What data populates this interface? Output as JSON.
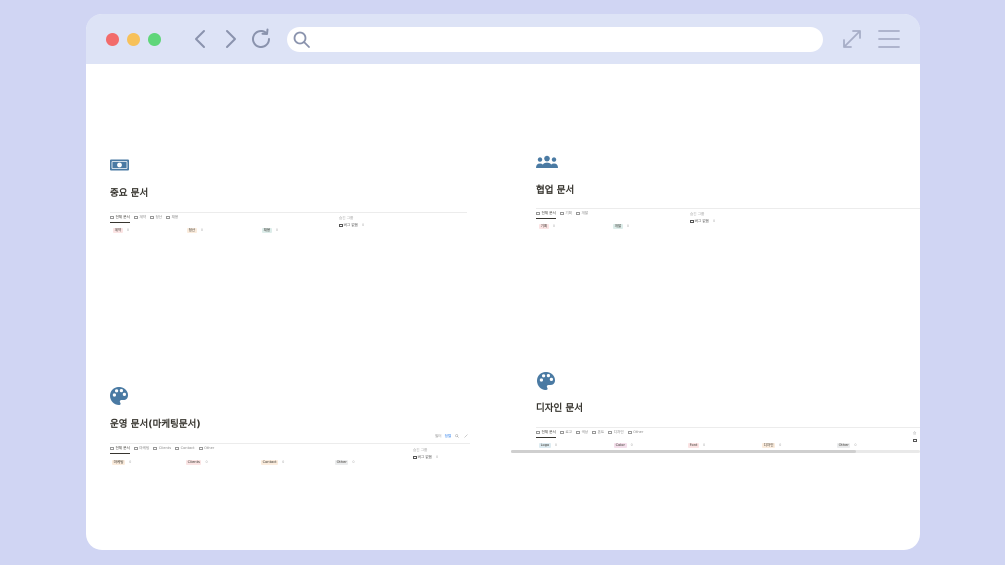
{
  "browser": {
    "url_value": "",
    "url_placeholder": "",
    "icons": [
      "back-icon",
      "forward-icon",
      "reload-icon",
      "search-icon",
      "expand-icon",
      "menu-icon"
    ]
  },
  "colors": {
    "background": "#d0d5f3",
    "titlebar": "#dde3f6",
    "section_icon": "#4a7aa3",
    "badge_red": "#fbe4e4",
    "badge_orange": "#fbecdd",
    "badge_green": "#ddedea",
    "badge_gray": "#ebeced",
    "badge_blue": "#ddebf1",
    "badge_purple": "#eae4f2",
    "badge_pink": "#f4dfeb"
  },
  "sections": {
    "important": {
      "icon": "money-icon",
      "title": "중요 문서",
      "tabs": [
        "전체 문서",
        "계약",
        "정산",
        "채용"
      ],
      "groups": [
        {
          "label": "계약",
          "count": "0"
        },
        {
          "label": "정산",
          "count": "0"
        },
        {
          "label": "채용",
          "count": "0"
        }
      ],
      "hidden_label": "숨긴 그룹",
      "hidden_item": "버그 없음",
      "hidden_count": "0"
    },
    "collab": {
      "icon": "people-icon",
      "title": "협업 문서",
      "tabs": [
        "전체 문서",
        "기획",
        "개발"
      ],
      "groups": [
        {
          "label": "기획",
          "count": "0"
        },
        {
          "label": "개발",
          "count": "0"
        }
      ],
      "hidden_label": "숨긴 그룹",
      "hidden_item": "버그 없음",
      "hidden_count": "0"
    },
    "ops": {
      "icon": "palette-icon",
      "title": "운영 문서(마케팅문서)",
      "tabs": [
        "전체 문서",
        "마케팅",
        "Clients",
        "Contact",
        "Other"
      ],
      "tools": [
        "필터",
        "정렬"
      ],
      "groups": [
        {
          "label": "마케팅",
          "count": "0"
        },
        {
          "label": "Clients",
          "count": "0"
        },
        {
          "label": "Contact",
          "count": "0"
        },
        {
          "label": "Other",
          "count": "0"
        }
      ],
      "hidden_label": "숨긴 그룹",
      "hidden_item": "버그 없음",
      "hidden_count": "0"
    },
    "design": {
      "icon": "palette-icon",
      "title": "디자인 문서",
      "tabs": [
        "전체 문서",
        "로고",
        "색상",
        "폰트",
        "디자인",
        "Other"
      ],
      "groups": [
        {
          "label": "Logo",
          "count": "0"
        },
        {
          "label": "Color",
          "count": "0"
        },
        {
          "label": "Font",
          "count": "0"
        },
        {
          "label": "디자인",
          "count": "0"
        },
        {
          "label": "Other",
          "count": "0"
        }
      ],
      "hidden_label": "숨",
      "hidden_item": ""
    }
  }
}
